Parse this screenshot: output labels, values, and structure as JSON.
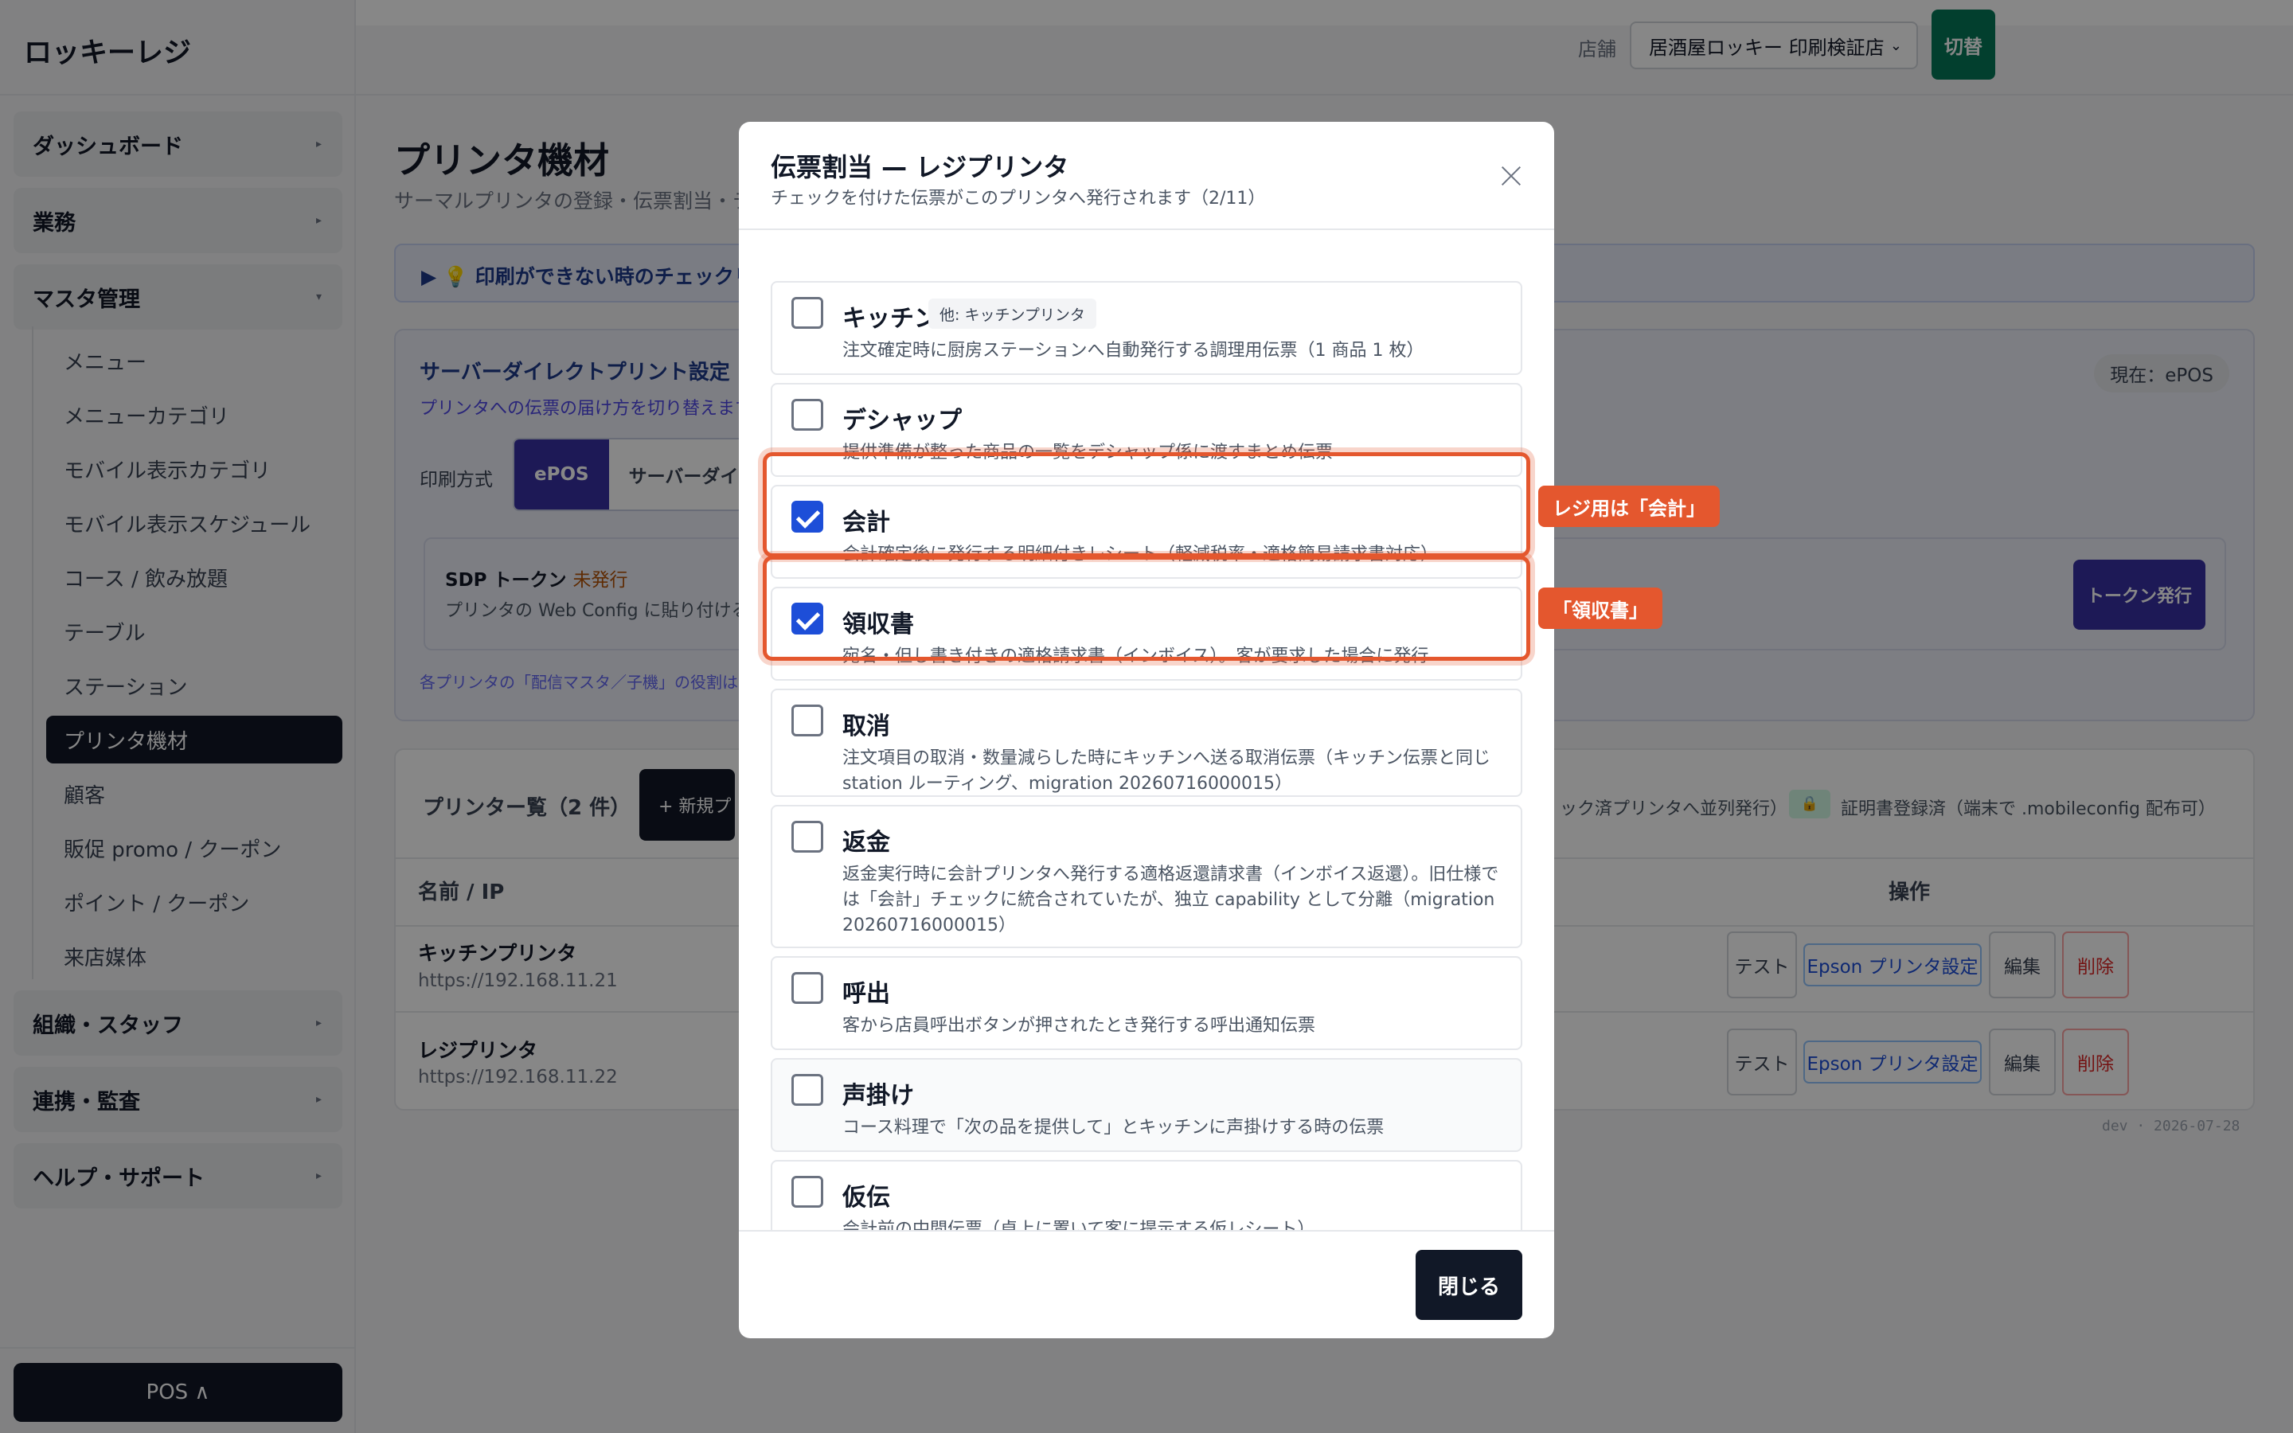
{
  "app": {
    "brand": "ロッキーレジ"
  },
  "header": {
    "store_label": "店舗",
    "store_value": "居酒屋ロッキー 印刷検証店",
    "switch_label": "切替"
  },
  "sidebar": {
    "groups": [
      {
        "label": "ダッシュボード"
      },
      {
        "label": "業務"
      },
      {
        "label": "マスタ管理"
      },
      {
        "label": "組織・スタッフ"
      },
      {
        "label": "連携・監査"
      },
      {
        "label": "ヘルプ・サポート"
      }
    ],
    "items": [
      {
        "label": "メニュー"
      },
      {
        "label": "メニューカテゴリ"
      },
      {
        "label": "モバイル表示カテゴリ"
      },
      {
        "label": "モバイル表示スケジュール"
      },
      {
        "label": "コース / 飲み放題"
      },
      {
        "label": "テーブル"
      },
      {
        "label": "ステーション"
      },
      {
        "label": "プリンタ機材"
      },
      {
        "label": "顧客"
      },
      {
        "label": "販促 promo / クーポン"
      },
      {
        "label": "ポイント / クーポン"
      },
      {
        "label": "来店媒体"
      }
    ],
    "pos_button": "POS ∧"
  },
  "page": {
    "title": "プリンタ機材",
    "subtitle": "サーマルプリンタの登録・伝票割当・テス",
    "tip": "印刷ができない時のチェックリ",
    "sdp_section": {
      "title": "サーバーダイレクトプリント設定",
      "desc": "プリンタへの伝票の届け方を切り替えます。",
      "current": "現在：ePOS",
      "method_label": "印刷方式",
      "methods": [
        "ePOS",
        "サーバーダイレクト"
      ],
      "token_title": "SDP トークン",
      "token_status": "未発行",
      "token_desc": "プリンタの Web Config に貼り付ける U",
      "token_button": "トークン発行",
      "note": "各プリンタの「配信マスタ／子機」の役割は、下"
    },
    "printer_list": {
      "title": "プリンター覧（2 件）",
      "new_button": "+ 新規プリ",
      "badge_parallel": "ック済プリンタへ並列発行）",
      "badge_lock": "🔒",
      "badge_cert": "証明書登録済（端末で .mobileconfig 配布可）",
      "col_name": "名前 / IP",
      "col_ops": "操作",
      "rows": [
        {
          "name": "キッチンプリンタ",
          "ip": "https://192.168.11.21"
        },
        {
          "name": "レジプリンタ",
          "ip": "https://192.168.11.22"
        }
      ],
      "ops": {
        "test": "テスト",
        "epson": "Epson プリンタ設定",
        "edit": "編集",
        "delete": "削除"
      }
    },
    "dev_footer": "dev · 2026-07-28"
  },
  "modal": {
    "title": "伝票割当 — レジプリンタ",
    "subtitle": "チェックを付けた伝票がこのプリンタへ発行されます（2/11）",
    "options": [
      {
        "label": "キッチン",
        "tag": "他: キッチンプリンタ",
        "checked": false,
        "desc": "注文確定時に厨房ステーションへ自動発行する調理用伝票（1 商品 1 枚）"
      },
      {
        "label": "デシャップ",
        "checked": false,
        "desc": "提供準備が整った商品の一覧をデシャップ係に渡すまとめ伝票"
      },
      {
        "label": "会計",
        "checked": true,
        "desc": "会計確定後に発行する明細付きレシート（軽減税率・適格簡易請求書対応）"
      },
      {
        "label": "領収書",
        "checked": true,
        "desc": "宛名・但し書き付きの適格請求書（インボイス）。客が要求した場合に発行"
      },
      {
        "label": "取消",
        "checked": false,
        "desc": "注文項目の取消・数量減らした時にキッチンへ送る取消伝票（キッチン伝票と同じ station ルーティング、migration 20260716000015）"
      },
      {
        "label": "返金",
        "checked": false,
        "desc": "返金実行時に会計プリンタへ発行する適格返還請求書（インボイス返還）。旧仕様では「会計」チェックに統合されていたが、独立 capability として分離（migration 20260716000015）"
      },
      {
        "label": "呼出",
        "checked": false,
        "desc": "客から店員呼出ボタンが押されたとき発行する呼出通知伝票"
      },
      {
        "label": "声掛け",
        "checked": false,
        "desc": "コース料理で「次の品を提供して」とキッチンに声掛けする時の伝票"
      },
      {
        "label": "仮伝",
        "checked": false,
        "desc": "会計前の中間伝票（卓上に置いて客に提示する仮レシート）"
      }
    ],
    "close_button": "閉じる"
  },
  "callouts": {
    "receipt": "レジ用は「会計」",
    "invoice": "「領収書」"
  },
  "colors": {
    "accent": "#3730a3",
    "highlight": "#e4572e",
    "switch": "#047857"
  }
}
